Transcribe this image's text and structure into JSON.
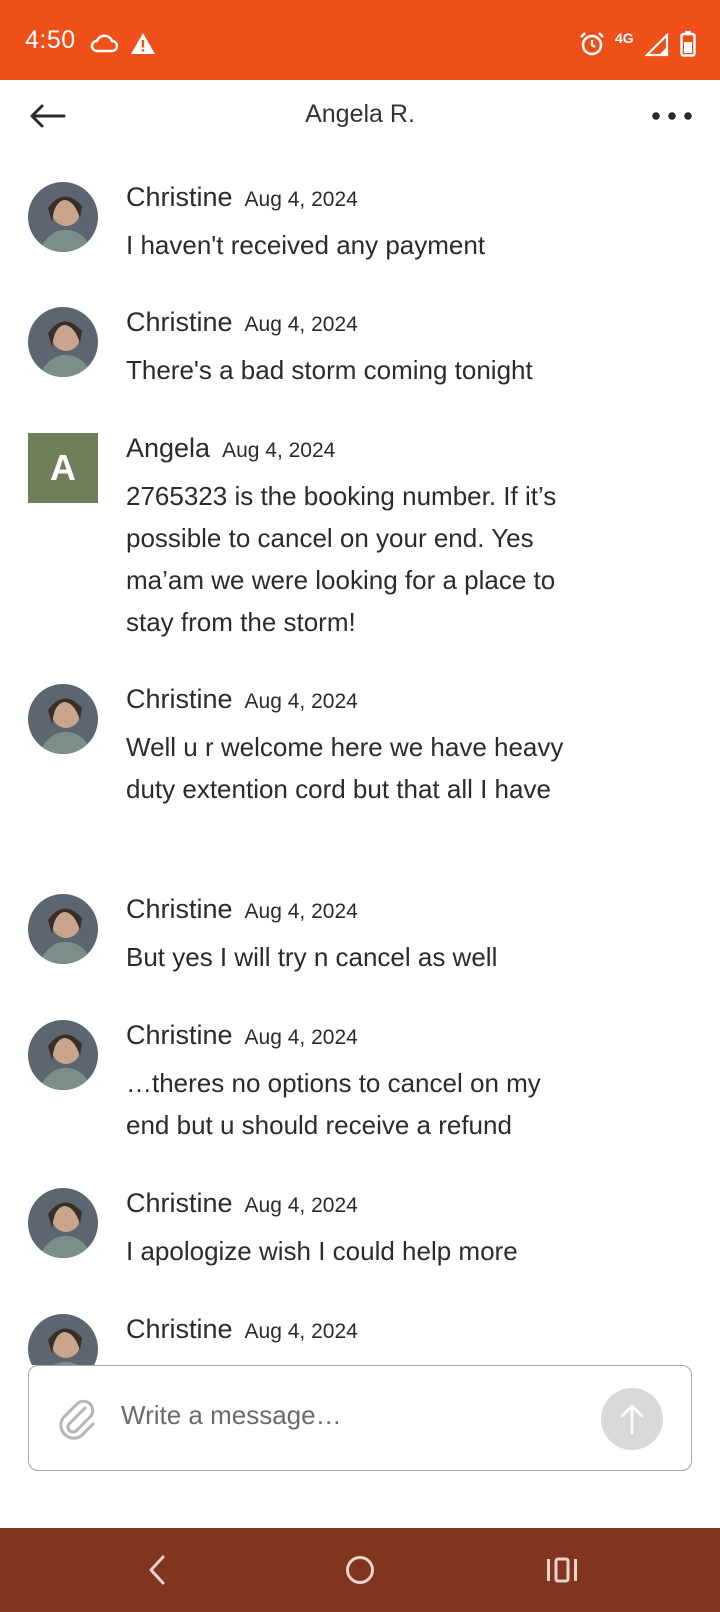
{
  "status_bar": {
    "time": "4:50",
    "network": "4G",
    "icons": [
      "cloud-icon",
      "warning-icon",
      "alarm-icon",
      "signal-icon",
      "battery-icon"
    ]
  },
  "header": {
    "title": "Angela R.",
    "back_icon": "arrow-left-icon",
    "more_icon": "more-horizontal-icon"
  },
  "messages": [
    {
      "sender": "Christine",
      "date": "Aug 4, 2024",
      "avatar": "photo",
      "text": "I haven't received any payment"
    },
    {
      "sender": "Christine",
      "date": "Aug 4, 2024",
      "avatar": "photo",
      "text": "There's a bad storm coming tonight"
    },
    {
      "sender": "Angela",
      "date": "Aug 4, 2024",
      "avatar": "letter",
      "initial": "A",
      "text": "2765323 is the booking number. If it’s possible to cancel on your end. Yes ma’am we were looking for a place to stay from the storm!"
    },
    {
      "sender": "Christine",
      "date": "Aug 4, 2024",
      "avatar": "photo",
      "text": "Well u r welcome here we have heavy duty extention cord but that all I have"
    },
    {
      "sender": "Christine",
      "date": "Aug 4, 2024",
      "avatar": "photo",
      "text": "But yes I will try n cancel as well"
    },
    {
      "sender": "Christine",
      "date": "Aug 4, 2024",
      "avatar": "photo",
      "text": "…theres no options to cancel on my end but u should receive a refund"
    },
    {
      "sender": "Christine",
      "date": "Aug 4, 2024",
      "avatar": "photo",
      "text": "I apologize wish I could help more"
    },
    {
      "sender": "Christine",
      "date": "Aug 4, 2024",
      "avatar": "photo",
      "text": ""
    }
  ],
  "composer": {
    "placeholder": "Write a message…",
    "attach_icon": "paperclip-icon",
    "send_icon": "arrow-up-icon"
  },
  "nav_bar": {
    "icons": [
      "back-nav-icon",
      "home-nav-icon",
      "recents-nav-icon"
    ]
  },
  "colors": {
    "status_bar": "#ef5019",
    "nav_bar": "#82351e",
    "letter_avatar": "#6f7f5a",
    "send_button": "#d9d9d9"
  }
}
